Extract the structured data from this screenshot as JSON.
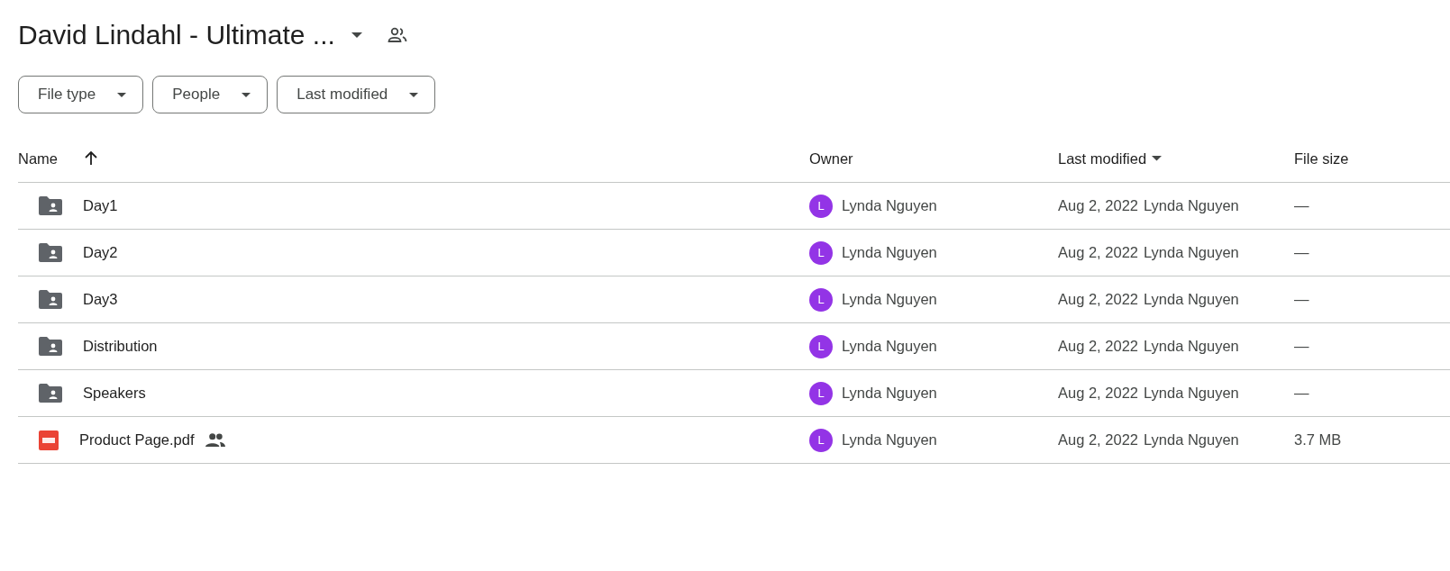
{
  "title": "David Lindahl - Ultimate ...",
  "title_shared": true,
  "filters": [
    {
      "label": "File type"
    },
    {
      "label": "People"
    },
    {
      "label": "Last modified"
    }
  ],
  "table": {
    "columns": [
      {
        "label": "Name",
        "sort_arrow": true,
        "sort_menu": false
      },
      {
        "label": "Owner",
        "sort_arrow": false,
        "sort_menu": false
      },
      {
        "label": "Last modified",
        "sort_arrow": false,
        "sort_menu": true
      },
      {
        "label": "File size",
        "sort_arrow": false,
        "sort_menu": false
      }
    ],
    "rows": [
      {
        "kind": "folder",
        "name": "Day1",
        "shared": false,
        "owner_initial": "L",
        "owner": "Lynda Nguyen",
        "modified": "Aug 2, 2022",
        "modified_by": "Lynda Nguyen",
        "size": "—"
      },
      {
        "kind": "folder",
        "name": "Day2",
        "shared": false,
        "owner_initial": "L",
        "owner": "Lynda Nguyen",
        "modified": "Aug 2, 2022",
        "modified_by": "Lynda Nguyen",
        "size": "—"
      },
      {
        "kind": "folder",
        "name": "Day3",
        "shared": false,
        "owner_initial": "L",
        "owner": "Lynda Nguyen",
        "modified": "Aug 2, 2022",
        "modified_by": "Lynda Nguyen",
        "size": "—"
      },
      {
        "kind": "folder",
        "name": "Distribution",
        "shared": false,
        "owner_initial": "L",
        "owner": "Lynda Nguyen",
        "modified": "Aug 2, 2022",
        "modified_by": "Lynda Nguyen",
        "size": "—"
      },
      {
        "kind": "folder",
        "name": "Speakers",
        "shared": false,
        "owner_initial": "L",
        "owner": "Lynda Nguyen",
        "modified": "Aug 2, 2022",
        "modified_by": "Lynda Nguyen",
        "size": "—"
      },
      {
        "kind": "pdf",
        "name": "Product Page.pdf",
        "shared": true,
        "owner_initial": "L",
        "owner": "Lynda Nguyen",
        "modified": "Aug 2, 2022",
        "modified_by": "Lynda Nguyen",
        "size": "3.7 MB"
      }
    ]
  }
}
